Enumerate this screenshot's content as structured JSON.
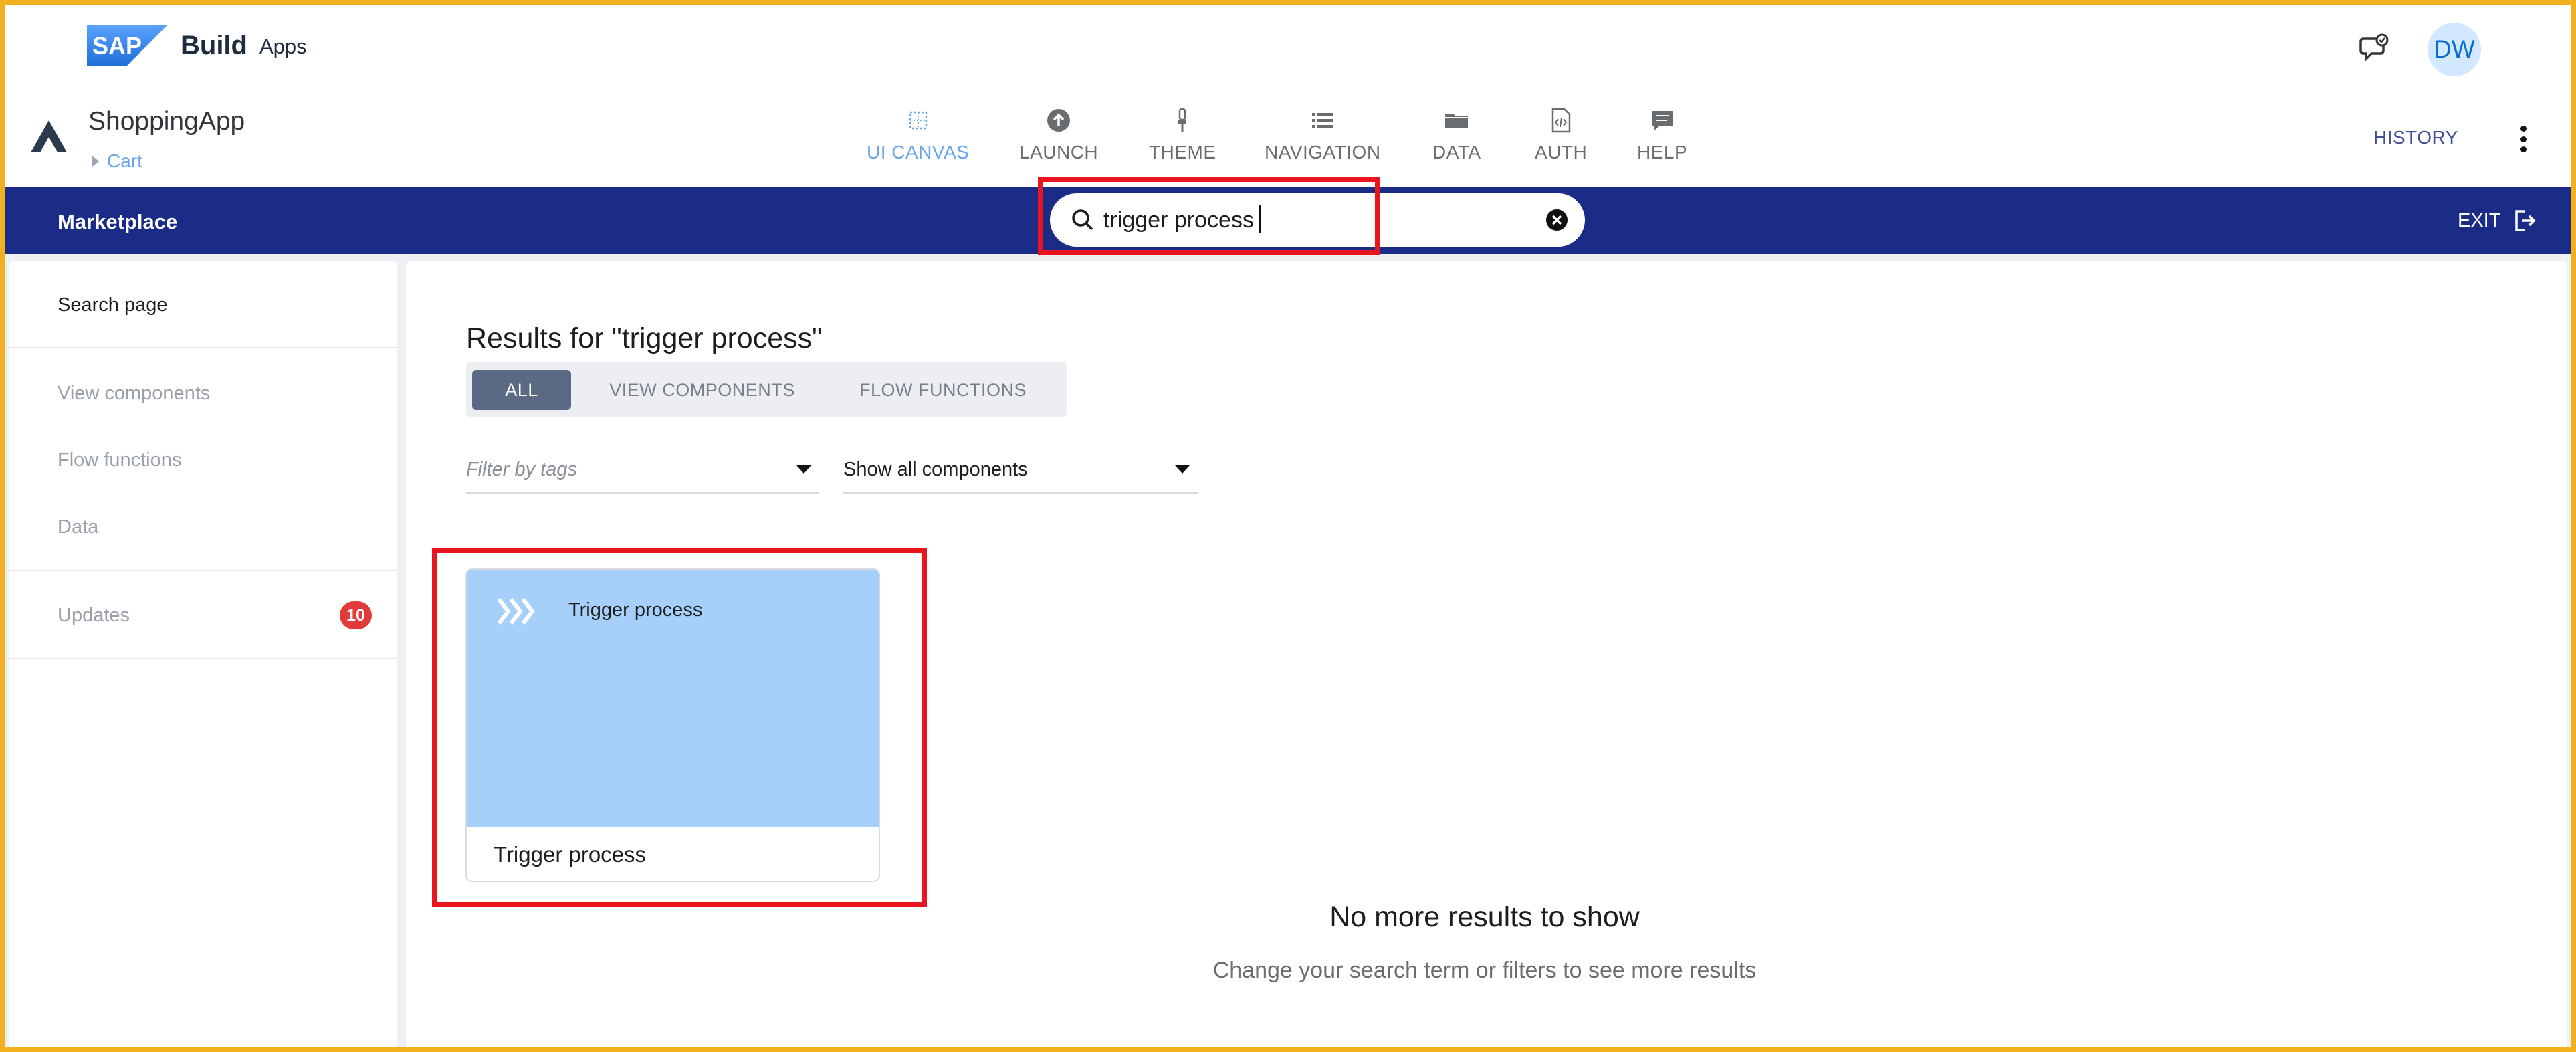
{
  "brand": {
    "sap": "SAP",
    "build": "Build",
    "apps": "Apps"
  },
  "user": {
    "initials": "DW"
  },
  "app": {
    "name": "ShoppingApp",
    "breadcrumb": "Cart"
  },
  "nav_tabs": [
    {
      "label": "UI CANVAS",
      "icon": "grid-icon",
      "active": true
    },
    {
      "label": "LAUNCH",
      "icon": "upload-icon"
    },
    {
      "label": "THEME",
      "icon": "brush-icon"
    },
    {
      "label": "NAVIGATION",
      "icon": "list-icon"
    },
    {
      "label": "DATA",
      "icon": "folder-icon"
    },
    {
      "label": "AUTH",
      "icon": "code-file-icon"
    },
    {
      "label": "HELP",
      "icon": "chat-icon"
    }
  ],
  "history_label": "HISTORY",
  "marketplace": {
    "title": "Marketplace",
    "search_value": "trigger process",
    "exit_label": "EXIT"
  },
  "sidebar": {
    "items": [
      {
        "label": "Search page"
      },
      {
        "label": "View components"
      },
      {
        "label": "Flow functions"
      },
      {
        "label": "Data"
      },
      {
        "label": "Updates",
        "badge": "10"
      }
    ]
  },
  "results": {
    "title": "Results for \"trigger process\"",
    "segments": [
      "ALL",
      "VIEW COMPONENTS",
      "FLOW FUNCTIONS"
    ],
    "active_segment": "ALL",
    "filter_tags_placeholder": "Filter by tags",
    "show_filter": "Show all components",
    "cards": [
      {
        "header": "Trigger process",
        "title": "Trigger process",
        "icon": "chevrons-right-icon"
      }
    ],
    "no_more_title": "No more results to show",
    "no_more_hint": "Change your search term or filters to see more results"
  },
  "colors": {
    "accent": "#1b2c87",
    "active_tab": "#6aa6e8",
    "card_bg": "#a6d0fa",
    "highlight": "#e8141e",
    "frame": "#f2b01e",
    "badge": "#e03b3b"
  }
}
